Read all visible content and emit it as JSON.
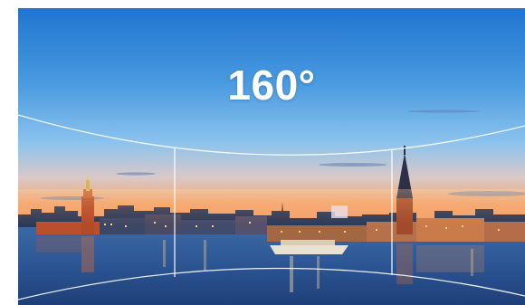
{
  "overlay": {
    "angle_label": "160°"
  },
  "scene": {
    "subject": "city-skyline-at-dusk-over-water",
    "colors": {
      "sky_top": "#2a7fd6",
      "sky_mid": "#6fb4ea",
      "horizon_glow": "#f6b07a",
      "water": "#2f5b9a",
      "guide_lines": "#ffffff"
    }
  }
}
